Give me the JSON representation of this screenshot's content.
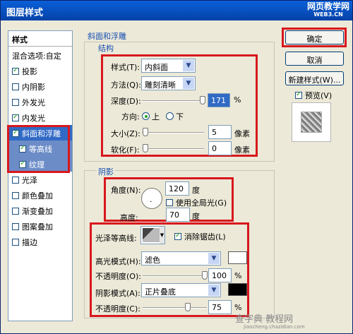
{
  "window": {
    "title": "图层样式",
    "watermark": "网页教学网",
    "watermark_sub": "WEB3.CN"
  },
  "sidebar": {
    "header": "样式",
    "items": [
      {
        "label": "混合选项:自定",
        "checked": false
      },
      {
        "label": "投影",
        "checked": true
      },
      {
        "label": "内阴影",
        "checked": false
      },
      {
        "label": "外发光",
        "checked": false
      },
      {
        "label": "内发光",
        "checked": true
      },
      {
        "label": "斜面和浮雕",
        "checked": true
      },
      {
        "label": "等高线",
        "checked": true
      },
      {
        "label": "纹理",
        "checked": true
      },
      {
        "label": "光泽",
        "checked": false
      },
      {
        "label": "颜色叠加",
        "checked": false
      },
      {
        "label": "渐变叠加",
        "checked": false
      },
      {
        "label": "图案叠加",
        "checked": false
      },
      {
        "label": "描边",
        "checked": false
      }
    ]
  },
  "bevel": {
    "section": "斜面和浮雕",
    "structure": "结构",
    "style_label": "样式(T):",
    "style_value": "内斜面",
    "method_label": "方法(Q):",
    "method_value": "雕刻清晰",
    "depth_label": "深度(D):",
    "depth_value": "171",
    "depth_unit": "%",
    "direction_label": "方向:",
    "up": "上",
    "down": "下",
    "size_label": "大小(Z):",
    "size_value": "5",
    "size_unit": "像素",
    "soften_label": "软化(F):",
    "soften_value": "0",
    "soften_unit": "像素",
    "shading": "阴影",
    "angle_label": "角度(N):",
    "angle_value": "120",
    "angle_unit": "度",
    "global_light": "使用全局光(G)",
    "altitude_label": "高度:",
    "altitude_value": "70",
    "altitude_unit": "度",
    "gloss_label": "光泽等高线:",
    "antialias": "消除锯齿(L)",
    "highlight_label": "高光模式(H):",
    "highlight_value": "滤色",
    "highlight_opacity_label": "不透明度(O):",
    "highlight_opacity": "100",
    "shadow_label": "阴影模式(A):",
    "shadow_value": "正片叠底",
    "shadow_opacity_label": "不透明度(C):",
    "shadow_opacity": "75",
    "percent": "%"
  },
  "actions": {
    "ok": "确定",
    "cancel": "取消",
    "new_style": "新建样式(W)...",
    "preview": "预览(V)"
  },
  "footer_watermark": "查字典 教程网",
  "footer_url": "jiaocheng.chazidian.com"
}
